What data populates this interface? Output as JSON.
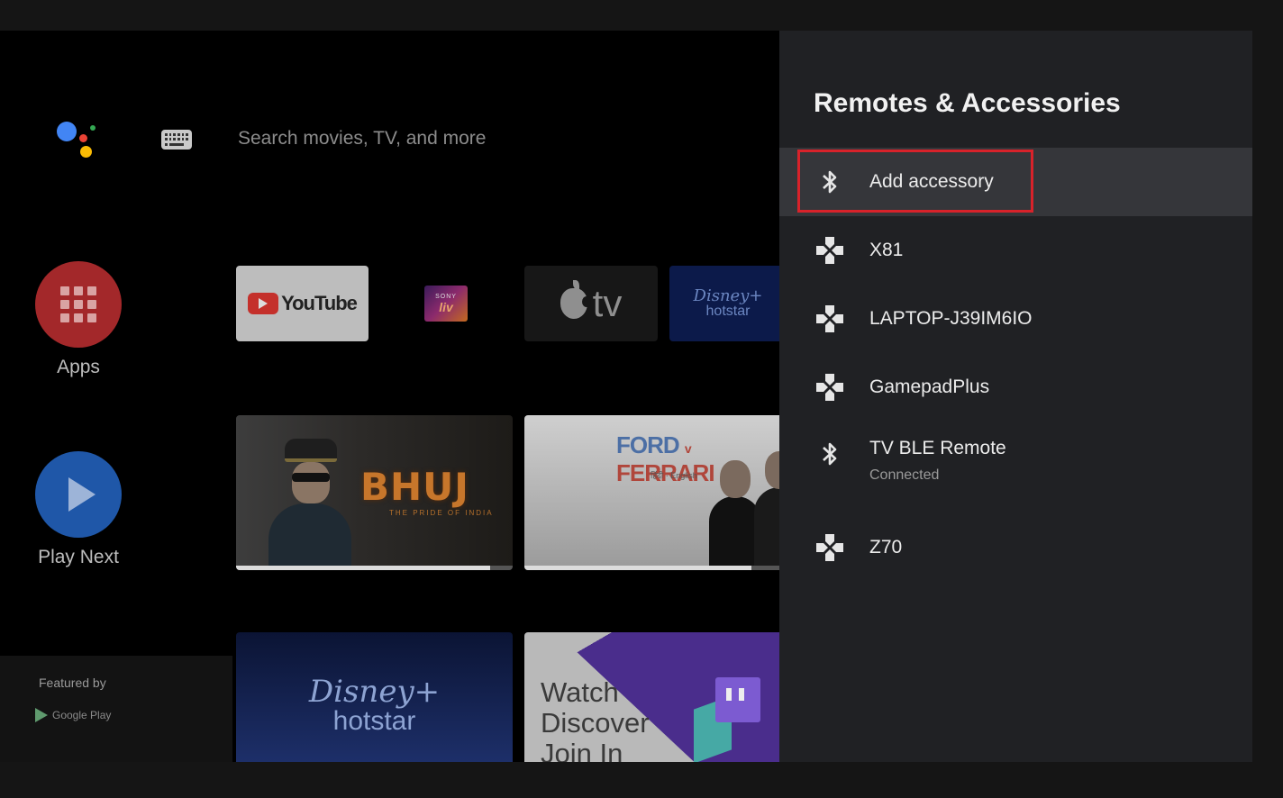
{
  "search": {
    "placeholder": "Search movies, TV, and more"
  },
  "sidebar": {
    "apps_label": "Apps",
    "play_next_label": "Play Next",
    "featured_by": "Featured by",
    "google_play": "Google Play"
  },
  "apps_row": {
    "youtube": "YouTube",
    "sonyliv_brand": "SONY",
    "sonyliv_name": "liv",
    "appletv_name": "tv",
    "hotstar_disney": "Disney+",
    "hotstar_name": "hotstar"
  },
  "continue_row": {
    "bhuj_title": "BHUJ",
    "bhuj_tagline": "THE PRIDE OF INDIA",
    "bhuj_progress": 0.92,
    "ford_title_a": "FORD",
    "ford_title_v": "v",
    "ford_title_b": "FERRARI",
    "ford_sub": "हिंदी · English",
    "ford_progress": 0.87
  },
  "promo_row": {
    "hotstar_disney": "Disney+",
    "hotstar_name": "hotstar",
    "twitch_words": [
      "Watch",
      "Discover",
      "Join In"
    ]
  },
  "panel": {
    "title": "Remotes & Accessories",
    "items": [
      {
        "label": "Add accessory",
        "icon": "bluetooth-icon",
        "selected": true
      },
      {
        "label": "X81",
        "icon": "gamepad-icon"
      },
      {
        "label": "LAPTOP-J39IM6IO",
        "icon": "gamepad-icon"
      },
      {
        "label": "GamepadPlus",
        "icon": "gamepad-icon"
      },
      {
        "label": "TV BLE Remote",
        "sublabel": "Connected",
        "icon": "bluetooth-icon"
      },
      {
        "label": "Z70",
        "icon": "gamepad-icon"
      }
    ]
  },
  "colors": {
    "highlight_border": "#d8222a",
    "panel_bg": "#202124",
    "selected_row": "#35363a"
  }
}
